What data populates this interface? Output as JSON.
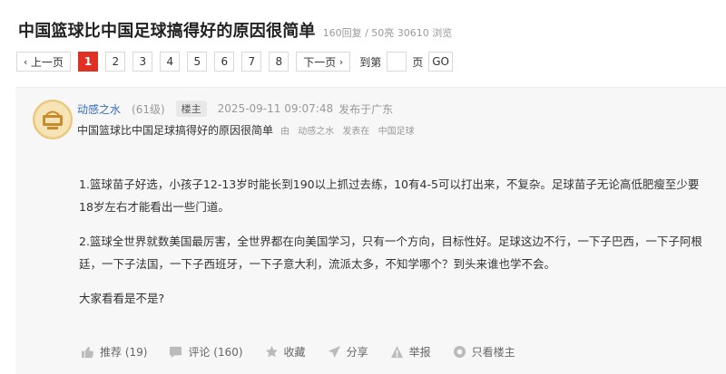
{
  "thread": {
    "title": "中国篮球比中国足球搞得好的原因很简单",
    "meta": "160回复 / 50亮 30610 浏览"
  },
  "pager": {
    "prev": "上一页",
    "pages": [
      "1",
      "2",
      "3",
      "4",
      "5",
      "6",
      "7",
      "8"
    ],
    "current": "1",
    "next": "下一页",
    "jump_label": "到第",
    "page_label": "页",
    "go": "GO"
  },
  "post": {
    "author": "动感之水",
    "level": "(61级)",
    "badge": "楼主",
    "time": "2025-09-11 09:07:48",
    "location": "发布于广东",
    "subject": "中国篮球比中国足球搞得好的原因很简单",
    "by": "由",
    "sub_author": "动感之水",
    "posted_in": "发表在",
    "board": "中国足球",
    "paragraphs": [
      "1.篮球苗子好选，小孩子12-13岁时能长到190以上抓过去练，10有4-5可以打出来，不复杂。足球苗子无论高低肥瘦至少要18岁左右才能看出一些门道。",
      "2.篮球全世界就数美国最厉害，全世界都在向美国学习，只有一个方向，目标性好。足球这边不行，一下子巴西，一下子阿根廷，一下子法国，一下子西班牙，一下子意大利，流派太多，不知学哪个？到头来谁也学不会。",
      "大家看看是不是?"
    ]
  },
  "actions": {
    "recommend": "推荐 (19)",
    "comment": "评论 (160)",
    "favorite": "收藏",
    "share": "分享",
    "report": "举报",
    "op_only": "只看楼主"
  }
}
